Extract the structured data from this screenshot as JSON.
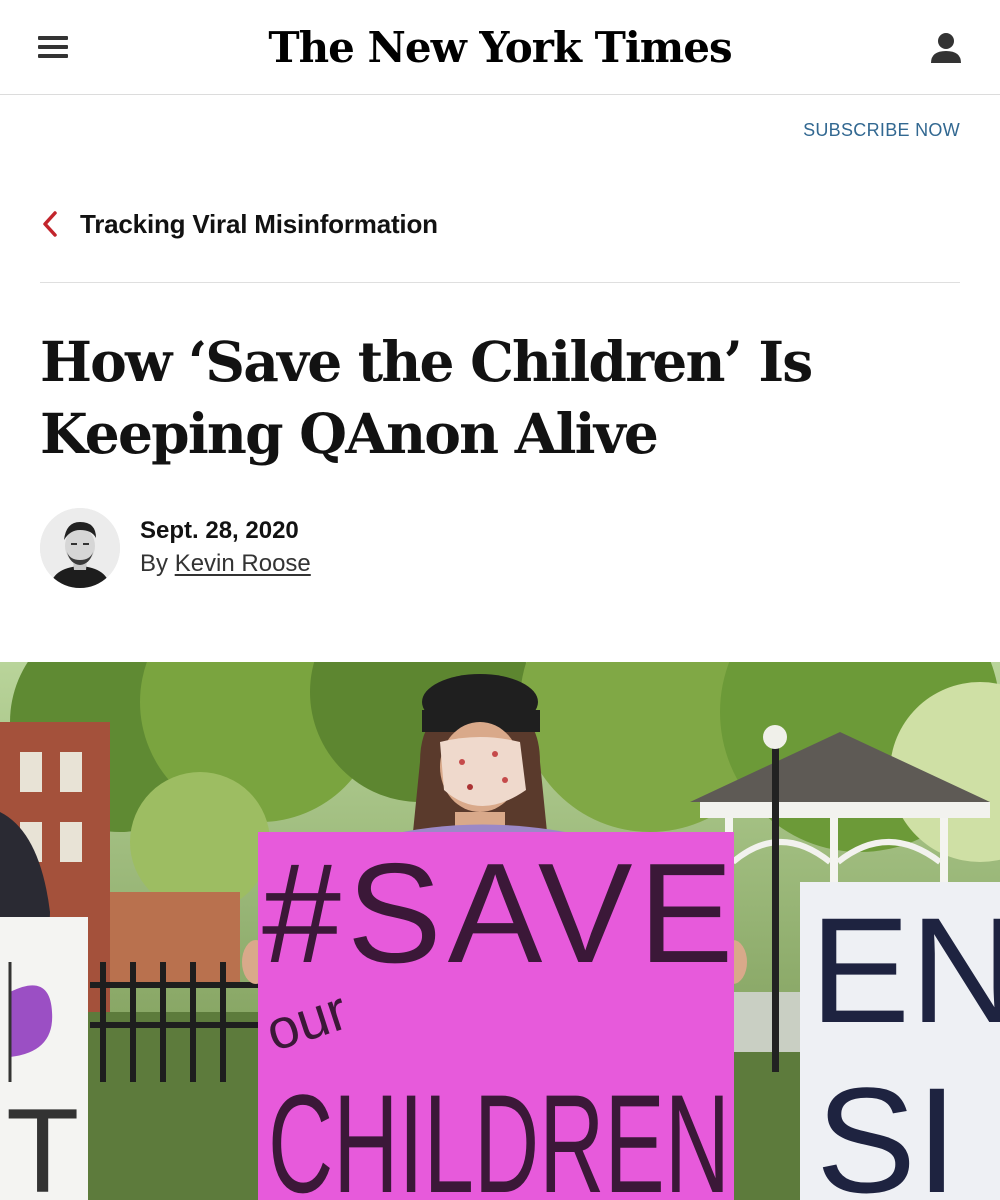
{
  "header": {
    "masthead": "The New York Times",
    "menu_icon": "hamburger-menu-icon",
    "account_icon": "user-account-icon"
  },
  "subscribe": {
    "label": "SUBSCRIBE NOW",
    "color": "#326891"
  },
  "section": {
    "label": "Tracking Viral Misinformation",
    "back_icon": "chevron-left-icon",
    "accent": "#c2252c"
  },
  "article": {
    "headline": "How ‘Save the Children’ Is Keeping QAnon Alive",
    "date": "Sept. 28, 2020",
    "byline_prefix": "By",
    "author": "Kevin Roose"
  },
  "photo": {
    "sign_center": [
      "#SAVE",
      "our",
      "CHILDREN"
    ],
    "sign_right": [
      "EN",
      "SI"
    ],
    "sign_left": [
      "T"
    ]
  }
}
